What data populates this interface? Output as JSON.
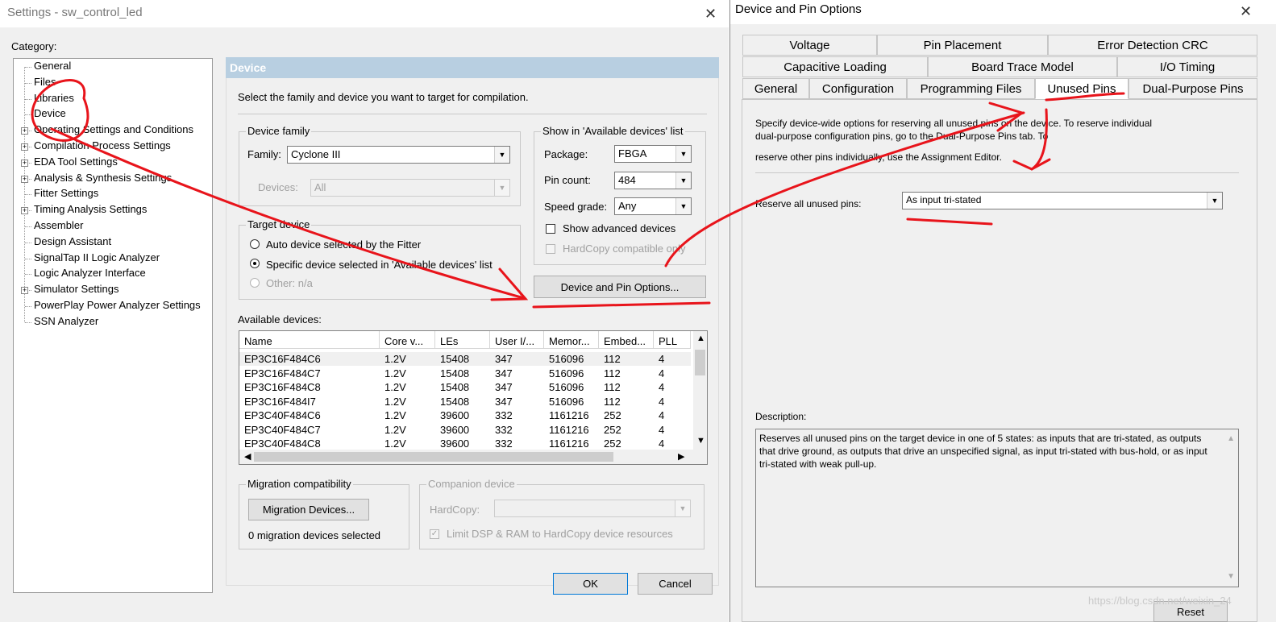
{
  "settings_window": {
    "title": "Settings - sw_control_led",
    "category_label": "Category:",
    "tree": [
      {
        "label": "General",
        "expandable": false
      },
      {
        "label": "Files",
        "expandable": false
      },
      {
        "label": "Libraries",
        "expandable": false
      },
      {
        "label": "Device",
        "expandable": false
      },
      {
        "label": "Operating Settings and Conditions",
        "expandable": true
      },
      {
        "label": "Compilation Process Settings",
        "expandable": true
      },
      {
        "label": "EDA Tool Settings",
        "expandable": true
      },
      {
        "label": "Analysis & Synthesis Settings",
        "expandable": true
      },
      {
        "label": "Fitter Settings",
        "expandable": false
      },
      {
        "label": "Timing Analysis Settings",
        "expandable": true
      },
      {
        "label": "Assembler",
        "expandable": false
      },
      {
        "label": "Design Assistant",
        "expandable": false
      },
      {
        "label": "SignalTap II Logic Analyzer",
        "expandable": false
      },
      {
        "label": "Logic Analyzer Interface",
        "expandable": false
      },
      {
        "label": "Simulator Settings",
        "expandable": true
      },
      {
        "label": "PowerPlay Power Analyzer Settings",
        "expandable": false
      },
      {
        "label": "SSN Analyzer",
        "expandable": false
      }
    ],
    "panel_header": "Device",
    "instruction": "Select the family and device you want to target for compilation.",
    "device_family": {
      "group_label": "Device family",
      "family_label": "Family:",
      "family_value": "Cyclone III",
      "devices_label": "Devices:",
      "devices_value": "All"
    },
    "show_available": {
      "group_label": "Show in 'Available devices' list",
      "package_label": "Package:",
      "package_value": "FBGA",
      "pin_count_label": "Pin count:",
      "pin_count_value": "484",
      "speed_grade_label": "Speed grade:",
      "speed_grade_value": "Any",
      "show_advanced": "Show advanced devices",
      "hardcopy_compatible": "HardCopy compatible only"
    },
    "target_device": {
      "group_label": "Target device",
      "auto": "Auto device selected by the Fitter",
      "specific": "Specific device selected in 'Available devices' list",
      "other": "Other:  n/a"
    },
    "device_pin_options_button": "Device and Pin Options...",
    "available_devices_label": "Available devices:",
    "columns": [
      "Name",
      "Core v...",
      "LEs",
      "User I/...",
      "Memor...",
      "Embed...",
      "PLL"
    ],
    "rows": [
      [
        "EP3C16F484C6",
        "1.2V",
        "15408",
        "347",
        "516096",
        "112",
        "4"
      ],
      [
        "EP3C16F484C7",
        "1.2V",
        "15408",
        "347",
        "516096",
        "112",
        "4"
      ],
      [
        "EP3C16F484C8",
        "1.2V",
        "15408",
        "347",
        "516096",
        "112",
        "4"
      ],
      [
        "EP3C16F484I7",
        "1.2V",
        "15408",
        "347",
        "516096",
        "112",
        "4"
      ],
      [
        "EP3C40F484C6",
        "1.2V",
        "39600",
        "332",
        "1161216",
        "252",
        "4"
      ],
      [
        "EP3C40F484C7",
        "1.2V",
        "39600",
        "332",
        "1161216",
        "252",
        "4"
      ],
      [
        "EP3C40F484C8",
        "1.2V",
        "39600",
        "332",
        "1161216",
        "252",
        "4"
      ]
    ],
    "migration": {
      "group_label": "Migration compatibility",
      "button": "Migration Devices...",
      "status": "0 migration devices selected"
    },
    "companion": {
      "group_label": "Companion device",
      "hardcopy_label": "HardCopy:",
      "limit_label": "Limit DSP & RAM to HardCopy device resources"
    },
    "ok": "OK",
    "cancel": "Cancel"
  },
  "pin_options_window": {
    "title": "Device and Pin Options",
    "tabs_row1": [
      "Voltage",
      "Pin Placement",
      "Error Detection CRC"
    ],
    "tabs_row2": [
      "Capacitive Loading",
      "Board Trace Model",
      "I/O Timing"
    ],
    "tabs_row3": [
      "General",
      "Configuration",
      "Programming Files",
      "Unused Pins",
      "Dual-Purpose Pins"
    ],
    "active_tab": "Unused Pins",
    "intro_line1": "Specify device-wide options for reserving all unused pins on the device. To reserve individual",
    "intro_line2": "dual-purpose configuration pins, go to the Dual-Purpose Pins tab. To",
    "intro_line3": "reserve other pins individually, use the Assignment Editor.",
    "reserve_label": "Reserve all unused pins:",
    "reserve_value": "As input tri-stated",
    "description_label": "Description:",
    "description_text": "Reserves all unused pins on the target device in one of 5 states: as inputs that are tri-stated, as outputs that drive ground, as outputs that drive an unspecified signal, as input tri-stated with bus-hold, or as input tri-stated with weak pull-up.",
    "reset_button": "Reset"
  },
  "watermark": "https://blog.csdn.net/weixin_24",
  "annotation_color": "#e8141b"
}
